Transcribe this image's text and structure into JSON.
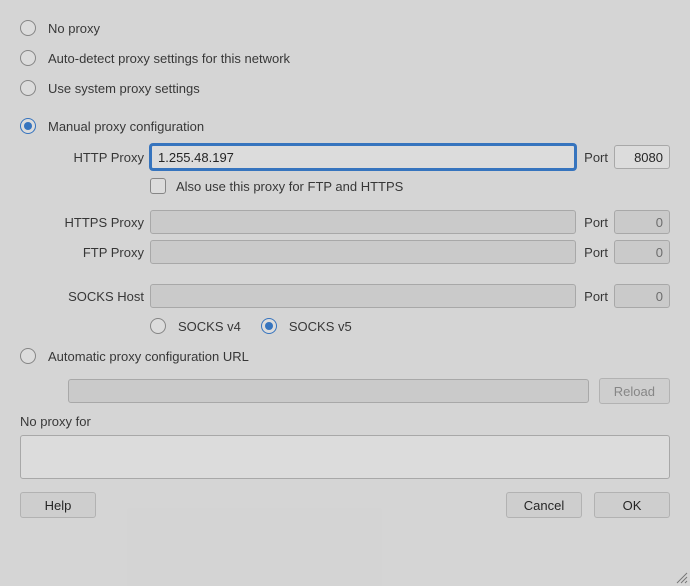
{
  "radios": {
    "no_proxy": "No proxy",
    "auto_detect": "Auto-detect proxy settings for this network",
    "use_system": "Use system proxy settings",
    "manual": "Manual proxy configuration",
    "auto_url": "Automatic proxy configuration URL"
  },
  "proxy": {
    "http_label": "HTTP Proxy",
    "http_value": "1.255.48.197",
    "http_port": "8080",
    "also_use_label": "Also use this proxy for FTP and HTTPS",
    "https_label": "HTTPS Proxy",
    "https_value": "",
    "https_port": "0",
    "ftp_label": "FTP Proxy",
    "ftp_value": "",
    "ftp_port": "0",
    "socks_label": "SOCKS Host",
    "socks_value": "",
    "socks_port": "0",
    "port_label": "Port",
    "socks_v4": "SOCKS v4",
    "socks_v5": "SOCKS v5"
  },
  "auto_url": {
    "value": "",
    "reload": "Reload"
  },
  "noproxy": {
    "label": "No proxy for",
    "value": ""
  },
  "buttons": {
    "help": "Help",
    "cancel": "Cancel",
    "ok": "OK"
  }
}
